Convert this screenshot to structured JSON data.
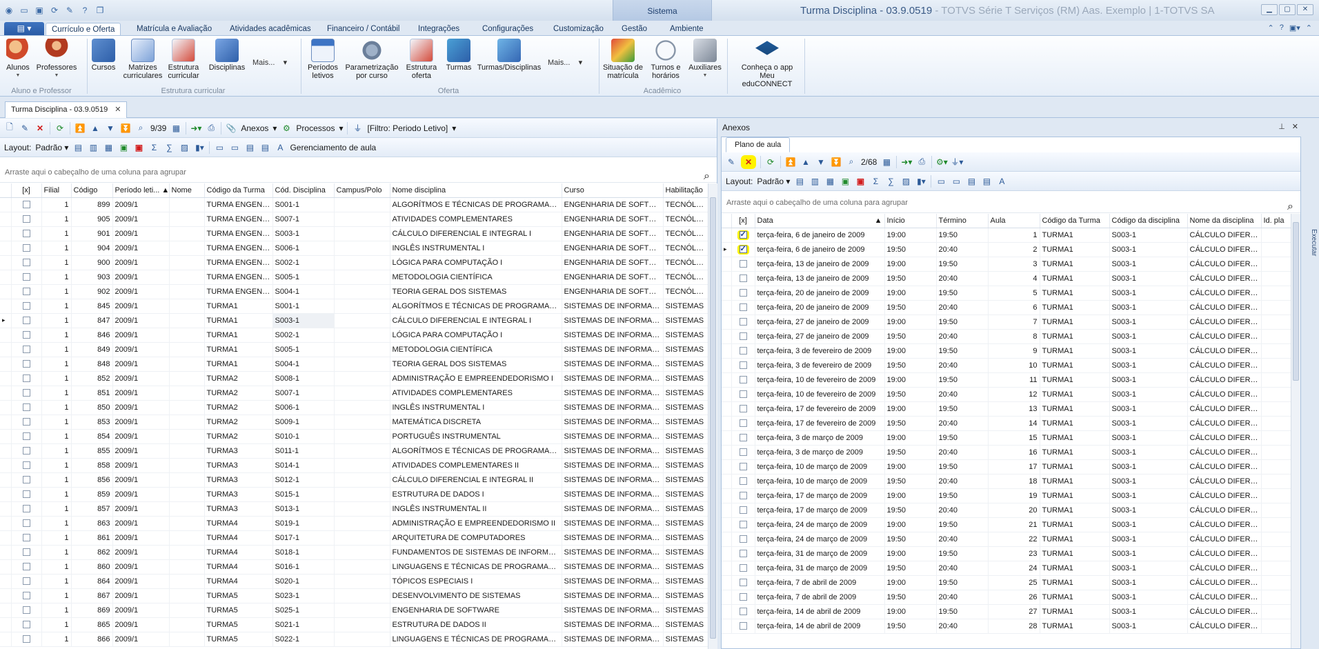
{
  "window": {
    "title": "Turma Disciplina - 03.9.0519",
    "title_dim": "- TOTVS Série T Serviços (RM) Aas. Exemplo | 1-TOTVS SA",
    "context_tab": "Sistema"
  },
  "ribbon_tabs": [
    {
      "label": "Currículo e Oferta"
    },
    {
      "label": "Matrícula e Avaliação"
    },
    {
      "label": "Atividades acadêmicas"
    },
    {
      "label": "Financeiro / Contábil"
    },
    {
      "label": "Integrações"
    },
    {
      "label": "Configurações"
    },
    {
      "label": "Customização"
    },
    {
      "label": "Gestão"
    },
    {
      "label": "Ambiente"
    }
  ],
  "ribbon": {
    "alunos": "Alunos",
    "professores": "Professores",
    "group_aluno_prof": "Aluno e Professor",
    "cursos": "Cursos",
    "matrizes": "Matrizes curriculares",
    "estrutura_curricular": "Estrutura curricular",
    "disciplinas": "Disciplinas",
    "mais": "Mais...",
    "group_estrutura": "Estrutura curricular",
    "periodos": "Períodos letivos",
    "parametrizacao": "Parametrização por curso",
    "estrutura_oferta": "Estrutura oferta",
    "turmas": "Turmas",
    "turmas_disciplinas": "Turmas/Disciplinas",
    "group_oferta": "Oferta",
    "situacao": "Situação de matrícula",
    "turnos": "Turnos e horários",
    "auxiliares": "Auxiliares",
    "group_academico": "Acadêmico",
    "educonnect": "Conheça o app Meu eduCONNECT"
  },
  "doc_tab": "Turma Disciplina - 03.9.0519",
  "left": {
    "record_count": "9/39",
    "anexos": "Anexos",
    "processos": "Processos",
    "filtro": "[Filtro: Periodo Letivo]",
    "layout_label": "Layout:",
    "layout_value": "Padrão",
    "gerenciamento": "Gerenciamento de aula",
    "group_hint": "Arraste aqui o cabeçalho de uma coluna para agrupar",
    "columns": [
      "[x]",
      "Filial",
      "Código",
      "Período leti...",
      "Nome",
      "Código da Turma",
      "Cód. Disciplina",
      "Campus/Polo",
      "Nome disciplina",
      "Curso",
      "Habilitação"
    ],
    "rows": [
      [
        "1",
        "899",
        "2009/1",
        "",
        "TURMA ENGENH...",
        "S001-1",
        "",
        "ALGORÍTMOS E TÉCNICAS DE PROGRAMAÇÃO I",
        "ENGENHARIA DE SOFTWA...",
        "TECNÓLOG"
      ],
      [
        "1",
        "905",
        "2009/1",
        "",
        "TURMA ENGENH...",
        "S007-1",
        "",
        "ATIVIDADES COMPLEMENTARES",
        "ENGENHARIA DE SOFTWA...",
        "TECNÓLOG"
      ],
      [
        "1",
        "901",
        "2009/1",
        "",
        "TURMA ENGENH...",
        "S003-1",
        "",
        "CÁLCULO DIFERENCIAL E INTEGRAL I",
        "ENGENHARIA DE SOFTWA...",
        "TECNÓLOG"
      ],
      [
        "1",
        "904",
        "2009/1",
        "",
        "TURMA ENGENH...",
        "S006-1",
        "",
        "INGLÊS INSTRUMENTAL I",
        "ENGENHARIA DE SOFTWA...",
        "TECNÓLOG"
      ],
      [
        "1",
        "900",
        "2009/1",
        "",
        "TURMA ENGENH...",
        "S002-1",
        "",
        "LÓGICA PARA COMPUTAÇÃO I",
        "ENGENHARIA DE SOFTWA...",
        "TECNÓLOG"
      ],
      [
        "1",
        "903",
        "2009/1",
        "",
        "TURMA ENGENH...",
        "S005-1",
        "",
        "METODOLOGIA CIENTÍFICA",
        "ENGENHARIA DE SOFTWA...",
        "TECNÓLOG"
      ],
      [
        "1",
        "902",
        "2009/1",
        "",
        "TURMA ENGENH...",
        "S004-1",
        "",
        "TEORIA GERAL DOS SISTEMAS",
        "ENGENHARIA DE SOFTWA...",
        "TECNÓLOG"
      ],
      [
        "1",
        "845",
        "2009/1",
        "",
        "TURMA1",
        "S001-1",
        "",
        "ALGORÍTMOS E TÉCNICAS DE PROGRAMAÇÃO I",
        "SISTEMAS DE INFORMAÇÃO",
        "SISTEMAS"
      ],
      [
        "1",
        "847",
        "2009/1",
        "",
        "TURMA1",
        "S003-1",
        "",
        "CÁLCULO DIFERENCIAL E INTEGRAL I",
        "SISTEMAS DE INFORMAÇÃO",
        "SISTEMAS"
      ],
      [
        "1",
        "846",
        "2009/1",
        "",
        "TURMA1",
        "S002-1",
        "",
        "LÓGICA PARA COMPUTAÇÃO I",
        "SISTEMAS DE INFORMAÇÃO",
        "SISTEMAS"
      ],
      [
        "1",
        "849",
        "2009/1",
        "",
        "TURMA1",
        "S005-1",
        "",
        "METODOLOGIA CIENTÍFICA",
        "SISTEMAS DE INFORMAÇÃO",
        "SISTEMAS"
      ],
      [
        "1",
        "848",
        "2009/1",
        "",
        "TURMA1",
        "S004-1",
        "",
        "TEORIA GERAL DOS SISTEMAS",
        "SISTEMAS DE INFORMAÇÃO",
        "SISTEMAS"
      ],
      [
        "1",
        "852",
        "2009/1",
        "",
        "TURMA2",
        "S008-1",
        "",
        "ADMINISTRAÇÃO E EMPREENDEDORISMO I",
        "SISTEMAS DE INFORMAÇÃO",
        "SISTEMAS"
      ],
      [
        "1",
        "851",
        "2009/1",
        "",
        "TURMA2",
        "S007-1",
        "",
        "ATIVIDADES COMPLEMENTARES",
        "SISTEMAS DE INFORMAÇÃO",
        "SISTEMAS"
      ],
      [
        "1",
        "850",
        "2009/1",
        "",
        "TURMA2",
        "S006-1",
        "",
        "INGLÊS INSTRUMENTAL I",
        "SISTEMAS DE INFORMAÇÃO",
        "SISTEMAS"
      ],
      [
        "1",
        "853",
        "2009/1",
        "",
        "TURMA2",
        "S009-1",
        "",
        "MATEMÁTICA DISCRETA",
        "SISTEMAS DE INFORMAÇÃO",
        "SISTEMAS"
      ],
      [
        "1",
        "854",
        "2009/1",
        "",
        "TURMA2",
        "S010-1",
        "",
        "PORTUGUÊS INSTRUMENTAL",
        "SISTEMAS DE INFORMAÇÃO",
        "SISTEMAS"
      ],
      [
        "1",
        "855",
        "2009/1",
        "",
        "TURMA3",
        "S011-1",
        "",
        "ALGORÍTMOS E TÉCNICAS DE PROGRAMAÇÃO II",
        "SISTEMAS DE INFORMAÇÃO",
        "SISTEMAS"
      ],
      [
        "1",
        "858",
        "2009/1",
        "",
        "TURMA3",
        "S014-1",
        "",
        "ATIVIDADES COMPLEMENTARES II",
        "SISTEMAS DE INFORMAÇÃO",
        "SISTEMAS"
      ],
      [
        "1",
        "856",
        "2009/1",
        "",
        "TURMA3",
        "S012-1",
        "",
        "CÁLCULO DIFERENCIAL E INTEGRAL II",
        "SISTEMAS DE INFORMAÇÃO",
        "SISTEMAS"
      ],
      [
        "1",
        "859",
        "2009/1",
        "",
        "TURMA3",
        "S015-1",
        "",
        "ESTRUTURA DE DADOS I",
        "SISTEMAS DE INFORMAÇÃO",
        "SISTEMAS"
      ],
      [
        "1",
        "857",
        "2009/1",
        "",
        "TURMA3",
        "S013-1",
        "",
        "INGLÊS INSTRUMENTAL II",
        "SISTEMAS DE INFORMAÇÃO",
        "SISTEMAS"
      ],
      [
        "1",
        "863",
        "2009/1",
        "",
        "TURMA4",
        "S019-1",
        "",
        "ADMINISTRAÇÃO E EMPREENDEDORISMO II",
        "SISTEMAS DE INFORMAÇÃO",
        "SISTEMAS"
      ],
      [
        "1",
        "861",
        "2009/1",
        "",
        "TURMA4",
        "S017-1",
        "",
        "ARQUITETURA DE COMPUTADORES",
        "SISTEMAS DE INFORMAÇÃO",
        "SISTEMAS"
      ],
      [
        "1",
        "862",
        "2009/1",
        "",
        "TURMA4",
        "S018-1",
        "",
        "FUNDAMENTOS DE SISTEMAS DE INFORMAÇÃO",
        "SISTEMAS DE INFORMAÇÃO",
        "SISTEMAS"
      ],
      [
        "1",
        "860",
        "2009/1",
        "",
        "TURMA4",
        "S016-1",
        "",
        "LINGUAGENS E TÉCNICAS DE PROGRAMAÇÃO I",
        "SISTEMAS DE INFORMAÇÃO",
        "SISTEMAS"
      ],
      [
        "1",
        "864",
        "2009/1",
        "",
        "TURMA4",
        "S020-1",
        "",
        "TÓPICOS ESPECIAIS I",
        "SISTEMAS DE INFORMAÇÃO",
        "SISTEMAS"
      ],
      [
        "1",
        "867",
        "2009/1",
        "",
        "TURMA5",
        "S023-1",
        "",
        "DESENVOLVIMENTO DE SISTEMAS",
        "SISTEMAS DE INFORMAÇÃO",
        "SISTEMAS"
      ],
      [
        "1",
        "869",
        "2009/1",
        "",
        "TURMA5",
        "S025-1",
        "",
        "ENGENHARIA DE SOFTWARE",
        "SISTEMAS DE INFORMAÇÃO",
        "SISTEMAS"
      ],
      [
        "1",
        "865",
        "2009/1",
        "",
        "TURMA5",
        "S021-1",
        "",
        "ESTRUTURA DE DADOS II",
        "SISTEMAS DE INFORMAÇÃO",
        "SISTEMAS"
      ],
      [
        "1",
        "866",
        "2009/1",
        "",
        "TURMA5",
        "S022-1",
        "",
        "LINGUAGENS E TÉCNICAS DE PROGRAMAÇÃO II",
        "SISTEMAS DE INFORMAÇÃO",
        "SISTEMAS"
      ]
    ],
    "current_row": 8
  },
  "right": {
    "panel_title": "Anexos",
    "inner_tab": "Plano de aula",
    "record_count": "2/68",
    "layout_label": "Layout:",
    "layout_value": "Padrão",
    "group_hint": "Arraste aqui o cabeçalho de uma coluna para agrupar",
    "columns": [
      "[x]",
      "Data",
      "Início",
      "Término",
      "Aula",
      "Código da Turma",
      "Código da disciplina",
      "Nome da disciplina",
      "Id. pla"
    ],
    "rows": [
      {
        "checked": true,
        "data": "terça-feira, 6 de janeiro de 2009",
        "inicio": "19:00",
        "termino": "19:50",
        "aula": "1",
        "turma": "TURMA1",
        "disc": "S003-1",
        "nome": "CÁLCULO DIFERE..."
      },
      {
        "checked": true,
        "data": "terça-feira, 6 de janeiro de 2009",
        "inicio": "19:50",
        "termino": "20:40",
        "aula": "2",
        "turma": "TURMA1",
        "disc": "S003-1",
        "nome": "CÁLCULO DIFERE..."
      },
      {
        "checked": false,
        "data": "terça-feira, 13 de janeiro de 2009",
        "inicio": "19:00",
        "termino": "19:50",
        "aula": "3",
        "turma": "TURMA1",
        "disc": "S003-1",
        "nome": "CÁLCULO DIFERE..."
      },
      {
        "checked": false,
        "data": "terça-feira, 13 de janeiro de 2009",
        "inicio": "19:50",
        "termino": "20:40",
        "aula": "4",
        "turma": "TURMA1",
        "disc": "S003-1",
        "nome": "CÁLCULO DIFERE..."
      },
      {
        "checked": false,
        "data": "terça-feira, 20 de janeiro de 2009",
        "inicio": "19:00",
        "termino": "19:50",
        "aula": "5",
        "turma": "TURMA1",
        "disc": "S003-1",
        "nome": "CÁLCULO DIFERE..."
      },
      {
        "checked": false,
        "data": "terça-feira, 20 de janeiro de 2009",
        "inicio": "19:50",
        "termino": "20:40",
        "aula": "6",
        "turma": "TURMA1",
        "disc": "S003-1",
        "nome": "CÁLCULO DIFERE..."
      },
      {
        "checked": false,
        "data": "terça-feira, 27 de janeiro de 2009",
        "inicio": "19:00",
        "termino": "19:50",
        "aula": "7",
        "turma": "TURMA1",
        "disc": "S003-1",
        "nome": "CÁLCULO DIFERE..."
      },
      {
        "checked": false,
        "data": "terça-feira, 27 de janeiro de 2009",
        "inicio": "19:50",
        "termino": "20:40",
        "aula": "8",
        "turma": "TURMA1",
        "disc": "S003-1",
        "nome": "CÁLCULO DIFERE..."
      },
      {
        "checked": false,
        "data": "terça-feira, 3 de fevereiro de 2009",
        "inicio": "19:00",
        "termino": "19:50",
        "aula": "9",
        "turma": "TURMA1",
        "disc": "S003-1",
        "nome": "CÁLCULO DIFERE..."
      },
      {
        "checked": false,
        "data": "terça-feira, 3 de fevereiro de 2009",
        "inicio": "19:50",
        "termino": "20:40",
        "aula": "10",
        "turma": "TURMA1",
        "disc": "S003-1",
        "nome": "CÁLCULO DIFERE..."
      },
      {
        "checked": false,
        "data": "terça-feira, 10 de fevereiro de 2009",
        "inicio": "19:00",
        "termino": "19:50",
        "aula": "11",
        "turma": "TURMA1",
        "disc": "S003-1",
        "nome": "CÁLCULO DIFERE..."
      },
      {
        "checked": false,
        "data": "terça-feira, 10 de fevereiro de 2009",
        "inicio": "19:50",
        "termino": "20:40",
        "aula": "12",
        "turma": "TURMA1",
        "disc": "S003-1",
        "nome": "CÁLCULO DIFERE..."
      },
      {
        "checked": false,
        "data": "terça-feira, 17 de fevereiro de 2009",
        "inicio": "19:00",
        "termino": "19:50",
        "aula": "13",
        "turma": "TURMA1",
        "disc": "S003-1",
        "nome": "CÁLCULO DIFERE..."
      },
      {
        "checked": false,
        "data": "terça-feira, 17 de fevereiro de 2009",
        "inicio": "19:50",
        "termino": "20:40",
        "aula": "14",
        "turma": "TURMA1",
        "disc": "S003-1",
        "nome": "CÁLCULO DIFERE..."
      },
      {
        "checked": false,
        "data": "terça-feira, 3 de março de 2009",
        "inicio": "19:00",
        "termino": "19:50",
        "aula": "15",
        "turma": "TURMA1",
        "disc": "S003-1",
        "nome": "CÁLCULO DIFERE..."
      },
      {
        "checked": false,
        "data": "terça-feira, 3 de março de 2009",
        "inicio": "19:50",
        "termino": "20:40",
        "aula": "16",
        "turma": "TURMA1",
        "disc": "S003-1",
        "nome": "CÁLCULO DIFERE..."
      },
      {
        "checked": false,
        "data": "terça-feira, 10 de março de 2009",
        "inicio": "19:00",
        "termino": "19:50",
        "aula": "17",
        "turma": "TURMA1",
        "disc": "S003-1",
        "nome": "CÁLCULO DIFERE..."
      },
      {
        "checked": false,
        "data": "terça-feira, 10 de março de 2009",
        "inicio": "19:50",
        "termino": "20:40",
        "aula": "18",
        "turma": "TURMA1",
        "disc": "S003-1",
        "nome": "CÁLCULO DIFERE..."
      },
      {
        "checked": false,
        "data": "terça-feira, 17 de março de 2009",
        "inicio": "19:00",
        "termino": "19:50",
        "aula": "19",
        "turma": "TURMA1",
        "disc": "S003-1",
        "nome": "CÁLCULO DIFERE..."
      },
      {
        "checked": false,
        "data": "terça-feira, 17 de março de 2009",
        "inicio": "19:50",
        "termino": "20:40",
        "aula": "20",
        "turma": "TURMA1",
        "disc": "S003-1",
        "nome": "CÁLCULO DIFERE..."
      },
      {
        "checked": false,
        "data": "terça-feira, 24 de março de 2009",
        "inicio": "19:00",
        "termino": "19:50",
        "aula": "21",
        "turma": "TURMA1",
        "disc": "S003-1",
        "nome": "CÁLCULO DIFERE..."
      },
      {
        "checked": false,
        "data": "terça-feira, 24 de março de 2009",
        "inicio": "19:50",
        "termino": "20:40",
        "aula": "22",
        "turma": "TURMA1",
        "disc": "S003-1",
        "nome": "CÁLCULO DIFERE..."
      },
      {
        "checked": false,
        "data": "terça-feira, 31 de março de 2009",
        "inicio": "19:00",
        "termino": "19:50",
        "aula": "23",
        "turma": "TURMA1",
        "disc": "S003-1",
        "nome": "CÁLCULO DIFERE..."
      },
      {
        "checked": false,
        "data": "terça-feira, 31 de março de 2009",
        "inicio": "19:50",
        "termino": "20:40",
        "aula": "24",
        "turma": "TURMA1",
        "disc": "S003-1",
        "nome": "CÁLCULO DIFERE..."
      },
      {
        "checked": false,
        "data": "terça-feira, 7 de abril de 2009",
        "inicio": "19:00",
        "termino": "19:50",
        "aula": "25",
        "turma": "TURMA1",
        "disc": "S003-1",
        "nome": "CÁLCULO DIFERE..."
      },
      {
        "checked": false,
        "data": "terça-feira, 7 de abril de 2009",
        "inicio": "19:50",
        "termino": "20:40",
        "aula": "26",
        "turma": "TURMA1",
        "disc": "S003-1",
        "nome": "CÁLCULO DIFERE..."
      },
      {
        "checked": false,
        "data": "terça-feira, 14 de abril de 2009",
        "inicio": "19:00",
        "termino": "19:50",
        "aula": "27",
        "turma": "TURMA1",
        "disc": "S003-1",
        "nome": "CÁLCULO DIFERE..."
      },
      {
        "checked": false,
        "data": "terça-feira, 14 de abril de 2009",
        "inicio": "19:50",
        "termino": "20:40",
        "aula": "28",
        "turma": "TURMA1",
        "disc": "S003-1",
        "nome": "CÁLCULO DIFERE..."
      }
    ],
    "current_row": 1
  },
  "executar": "Executar",
  "colors": {
    "accent": "#2a5ba5",
    "highlight": "#fff200",
    "delete": "#d21c1c"
  }
}
